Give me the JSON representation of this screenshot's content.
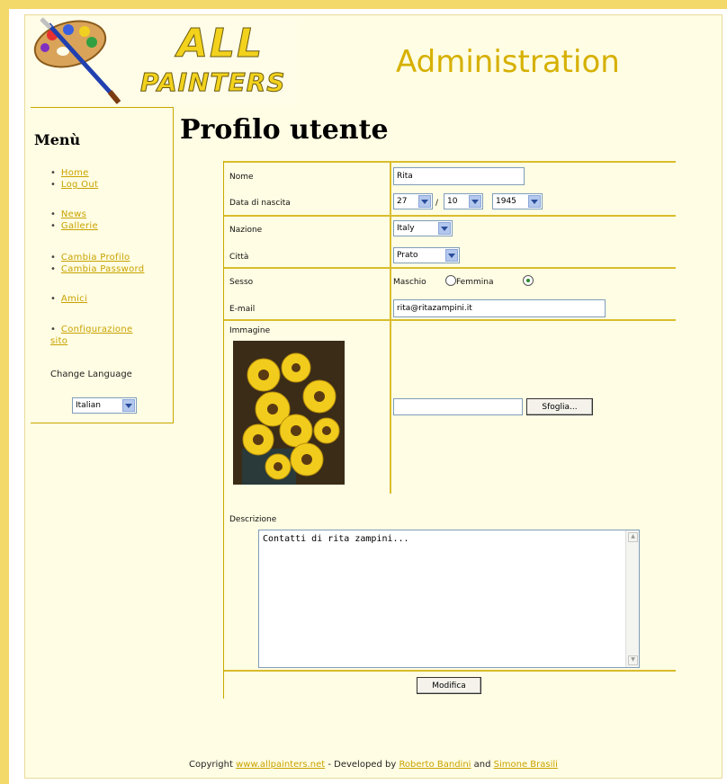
{
  "header": {
    "logo_text_line1": "ALL",
    "logo_text_line2": "PAINTERS",
    "section_title": "Administration"
  },
  "sidebar": {
    "title": "Menù",
    "groups": [
      [
        "Home",
        "Log Out"
      ],
      [
        "News",
        "Gallerie"
      ],
      [
        "Cambia Profilo",
        "Cambia Password"
      ],
      [
        "Amici"
      ],
      [
        "Configurazione sito"
      ]
    ],
    "language_label": "Change Language",
    "language_value": "Italian"
  },
  "page_title": "Profilo utente",
  "form": {
    "nome_label": "Nome",
    "nome_value": "Rita",
    "nascita_label": "Data di nascita",
    "day_value": "27",
    "month_value": "10",
    "year_value": "1945",
    "date_separator": "/",
    "nazione_label": "Nazione",
    "nazione_value": "Italy",
    "citta_label": "Città",
    "citta_value": "Prato",
    "sesso_label": "Sesso",
    "sesso_text": "Maschio",
    "sesso_option_femmina": "Femmina",
    "email_label": "E-mail",
    "email_value": "rita@ritazampini.it",
    "immagine_label": "Immagine",
    "browse_label": "Sfoglia...",
    "descrizione_label": "Descrizione",
    "descrizione_value": "Contatti di rita zampini...",
    "submit_label": "Modifica"
  },
  "footer": {
    "copyright": "Copyright",
    "site_link": "www.allpainters.net",
    "developed_by": " - Developed by ",
    "author1": "Roberto Bandini",
    "and": " and ",
    "author2": "Simone Brasili"
  },
  "colors": {
    "accent": "#c8a200",
    "background": "#fffde3",
    "border": "#d9bd2d"
  }
}
